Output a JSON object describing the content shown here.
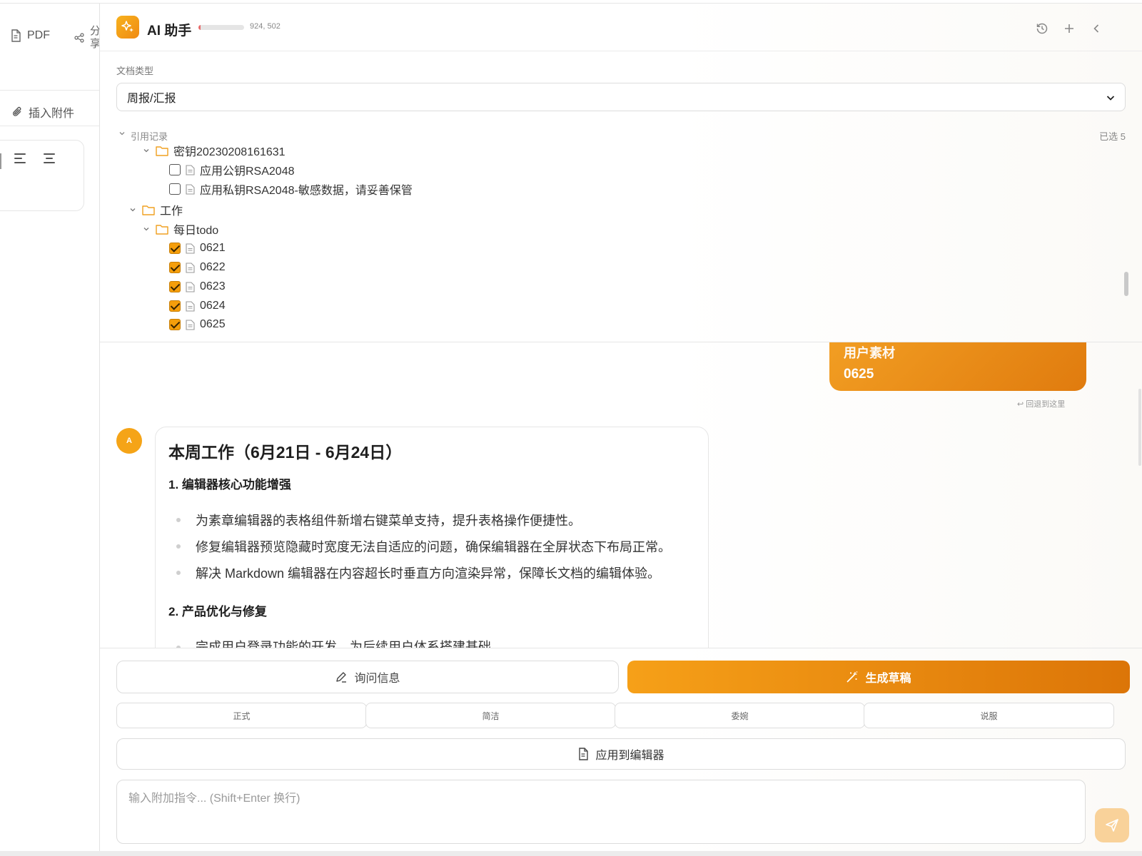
{
  "left_toolbar": {
    "pdf_label": "PDF",
    "share_label": "分享",
    "attach_label": "插入附件"
  },
  "header": {
    "title": "AI 助手",
    "usage_text": "924, 502",
    "usage_fraction": 0.05,
    "icons": [
      "history-icon",
      "plus-icon",
      "collapse-icon"
    ]
  },
  "doc_type": {
    "label": "文档类型",
    "selected": "周报/汇报"
  },
  "references": {
    "label": "引用记录",
    "selected_count": "已选 5",
    "tree": [
      {
        "type": "folder",
        "name": "密钥20230208161631"
      },
      {
        "type": "file",
        "name": "应用公钥RSA2048",
        "checked": false
      },
      {
        "type": "file",
        "name": "应用私钥RSA2048-敏感数据，请妥善保管",
        "checked": false
      },
      {
        "type": "folder",
        "name": "工作"
      },
      {
        "type": "folder",
        "name": "每日todo"
      },
      {
        "type": "file",
        "name": "0621",
        "checked": true
      },
      {
        "type": "file",
        "name": "0622",
        "checked": true
      },
      {
        "type": "file",
        "name": "0623",
        "checked": true
      },
      {
        "type": "file",
        "name": "0624",
        "checked": true
      },
      {
        "type": "file",
        "name": "0625",
        "checked": true
      }
    ]
  },
  "chat": {
    "user_message": {
      "line1": "用户素材",
      "line2": "0625"
    },
    "rollback_label": "回退到这里",
    "ai_avatar": "A",
    "ai_message": {
      "heading": "本周工作（6月21日 - 6月24日）",
      "section1": "1. 编辑器核心功能增强",
      "bullets1": [
        "为素章编辑器的表格组件新增右键菜单支持，提升表格操作便捷性。",
        "修复编辑器预览隐藏时宽度无法自适应的问题，确保编辑器在全屏状态下布局正常。",
        "解决 Markdown 编辑器在内容超长时垂直方向渲染异常，保障长文档的编辑体验。"
      ],
      "section2": "2. 产品优化与修复",
      "bullets2": [
        "完成用户登录功能的开发，为后续用户体系搭建基础"
      ]
    }
  },
  "actions": {
    "ask_label": "询问信息",
    "generate_label": "生成草稿",
    "tones": [
      "正式",
      "简洁",
      "委婉",
      "说服"
    ],
    "apply_label": "应用到编辑器"
  },
  "prompt": {
    "placeholder": "输入附加指令... (Shift+Enter 换行)"
  },
  "colors": {
    "accent": "#f59e0b",
    "accent_dark": "#dc7508",
    "send_button": "#f9d29a"
  }
}
